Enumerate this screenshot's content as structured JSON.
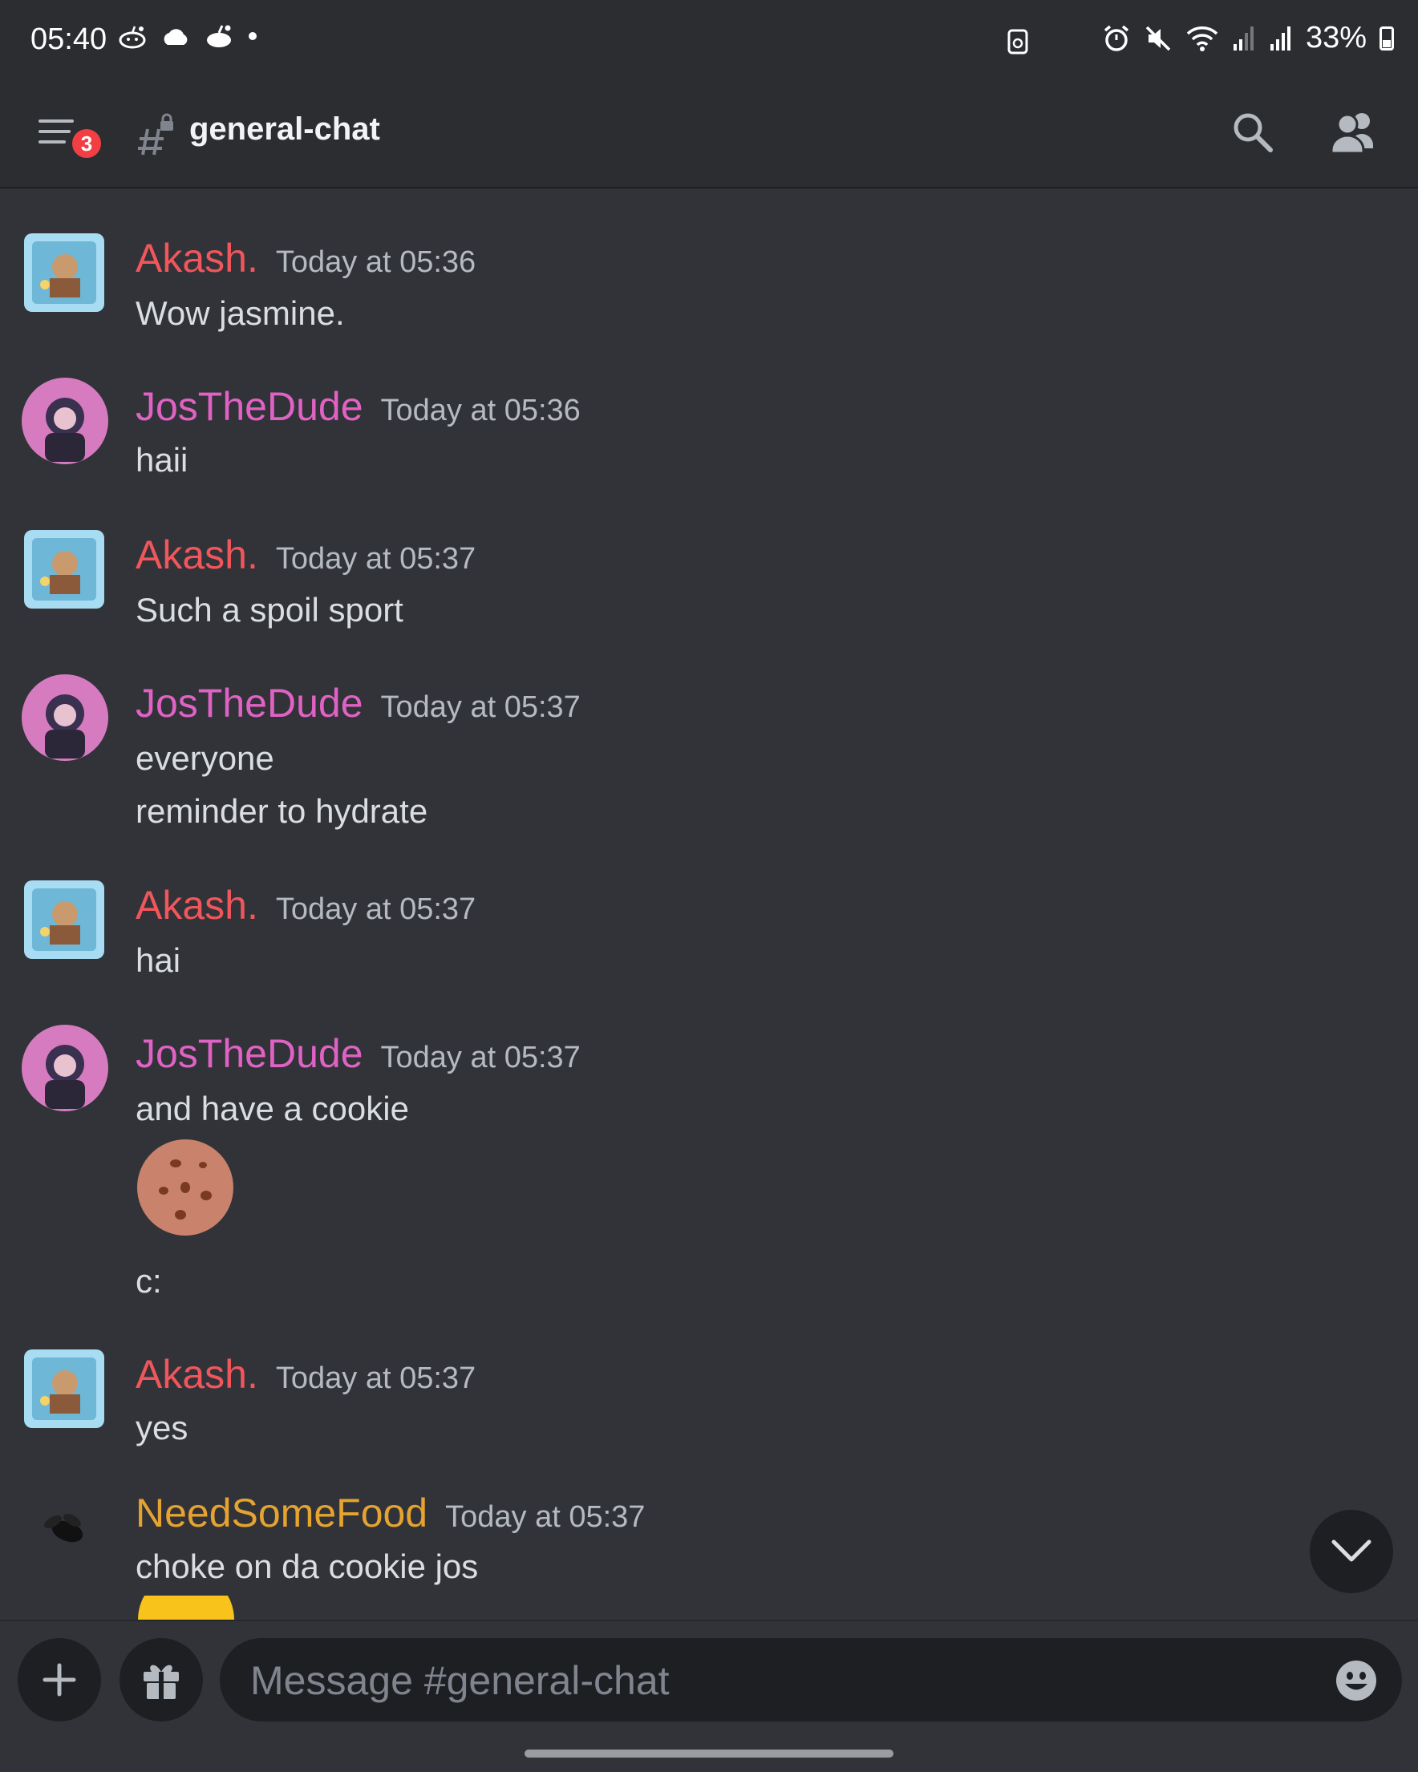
{
  "status_bar": {
    "time": "05:40",
    "battery": "33%",
    "icons": [
      "reddit-icon",
      "cloud-icon",
      "reddit-icon",
      "dot-icon",
      "screenshot-icon",
      "alarm-icon",
      "mute-icon",
      "wifi-icon",
      "signal-icon",
      "signal-icon",
      "battery-icon"
    ]
  },
  "header": {
    "channel_name": "general-chat",
    "notification_count": "3",
    "icons": [
      "menu-icon",
      "locked-hash-icon",
      "search-icon",
      "members-icon"
    ]
  },
  "messages": [
    {
      "author": "Akash.",
      "time": "Today at 05:36",
      "color": "#f0565b",
      "lines": [
        "Wow jasmine."
      ]
    },
    {
      "author": "JosTheDude",
      "time": "Today at 05:36",
      "color": "#e062c4",
      "lines": [
        "haii"
      ]
    },
    {
      "author": "Akash.",
      "time": "Today at 05:37",
      "color": "#f0565b",
      "lines": [
        "Such a spoil sport"
      ]
    },
    {
      "author": "JosTheDude",
      "time": "Today at 05:37",
      "color": "#e062c4",
      "lines": [
        "everyone",
        "reminder to hydrate"
      ]
    },
    {
      "author": "Akash.",
      "time": "Today at 05:37",
      "color": "#f0565b",
      "lines": [
        "hai"
      ]
    },
    {
      "author": "JosTheDude",
      "time": "Today at 05:37",
      "color": "#e062c4",
      "lines": [
        "and have a cookie",
        "c:"
      ],
      "emoji": "cookie-emoji"
    },
    {
      "author": "Akash.",
      "time": "Today at 05:37",
      "color": "#f0565b",
      "lines": [
        "yes"
      ]
    },
    {
      "author": "NeedSomeFood",
      "time": "Today at 05:37",
      "color": "#e5a330",
      "lines": [
        "choke on da cookie jos"
      ],
      "emoji": "yellow-emoji-partial"
    }
  ],
  "composer": {
    "placeholder": "Message #general-chat",
    "icons": [
      "plus-icon",
      "gift-icon",
      "emoji-icon"
    ]
  },
  "colors": {
    "background": "#313338",
    "header_bg": "#2b2d31",
    "input_bg": "#1e1f22",
    "badge": "#f23f43"
  }
}
